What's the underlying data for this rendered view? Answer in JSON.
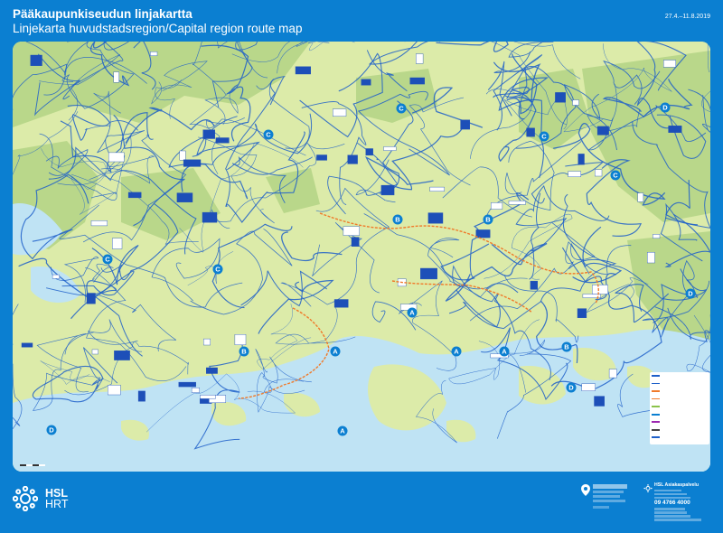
{
  "header": {
    "title": "Pääkaupunkiseudun linjakartta",
    "subtitle": "Linjekarta huvudstadsregion/Capital region route map",
    "date": "27.4.–11.8.2019"
  },
  "map": {
    "zone_labels": [
      {
        "letter": "A"
      },
      {
        "letter": "A"
      },
      {
        "letter": "A"
      },
      {
        "letter": "A"
      },
      {
        "letter": "A"
      },
      {
        "letter": "B"
      },
      {
        "letter": "B"
      },
      {
        "letter": "B"
      },
      {
        "letter": "B"
      },
      {
        "letter": "C"
      },
      {
        "letter": "C"
      },
      {
        "letter": "C"
      },
      {
        "letter": "C"
      },
      {
        "letter": "C"
      },
      {
        "letter": "C"
      },
      {
        "letter": "D"
      },
      {
        "letter": "D"
      },
      {
        "letter": "D"
      },
      {
        "letter": "D"
      }
    ],
    "colors": {
      "land": "#dceba9",
      "forest": "#b9d78a",
      "water": "#bfe3f4",
      "route": "#1d5fc9",
      "metro": "#f07a2a",
      "frame": "#0b7fd1"
    }
  },
  "footer": {
    "logo_line1": "HSL",
    "logo_line2": "HRT",
    "info_title": "HSL Asiakaspalvelu",
    "info_phone": "09 4766 4000",
    "icons": [
      "hsl-logo-icon",
      "location-pin-icon",
      "hsl-small-logo-icon"
    ]
  }
}
